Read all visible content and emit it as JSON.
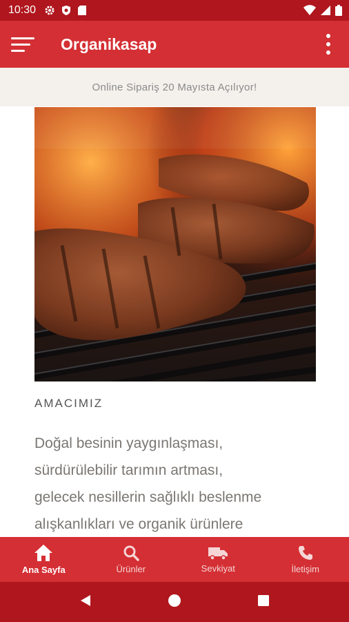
{
  "status_bar": {
    "time": "10:30",
    "left_icons": [
      "gear-icon",
      "shield-icon",
      "sd-card-icon"
    ],
    "right_icons": [
      "wifi-icon",
      "signal-icon",
      "battery-icon"
    ]
  },
  "app_bar": {
    "title": "Organikasap",
    "menu_icon": "hamburger-menu-icon",
    "more_icon": "more-vertical-icon"
  },
  "announcement": "Online Sipariş 20 Mayısta Açılıyor!",
  "hero_image": "grilled-steaks-on-flaming-grill",
  "section": {
    "title": "AMACIMIZ",
    "lines": [
      "Doğal besinin yaygınlaşması,",
      "sürdürülebilir tarımın artması,",
      "gelecek nesillerin sağlıklı beslenme",
      "alışkanlıkları ve organik ürünlere"
    ]
  },
  "bottom_nav": [
    {
      "label": "Ana Sayfa",
      "icon": "home-icon",
      "active": true
    },
    {
      "label": "Ürünler",
      "icon": "search-icon",
      "active": false
    },
    {
      "label": "Sevkiyat",
      "icon": "truck-icon",
      "active": false
    },
    {
      "label": "İletişim",
      "icon": "phone-icon",
      "active": false
    }
  ],
  "colors": {
    "primary": "#d42f34",
    "primary_dark": "#b0161d",
    "announcement_bg": "#f4f1ec"
  }
}
